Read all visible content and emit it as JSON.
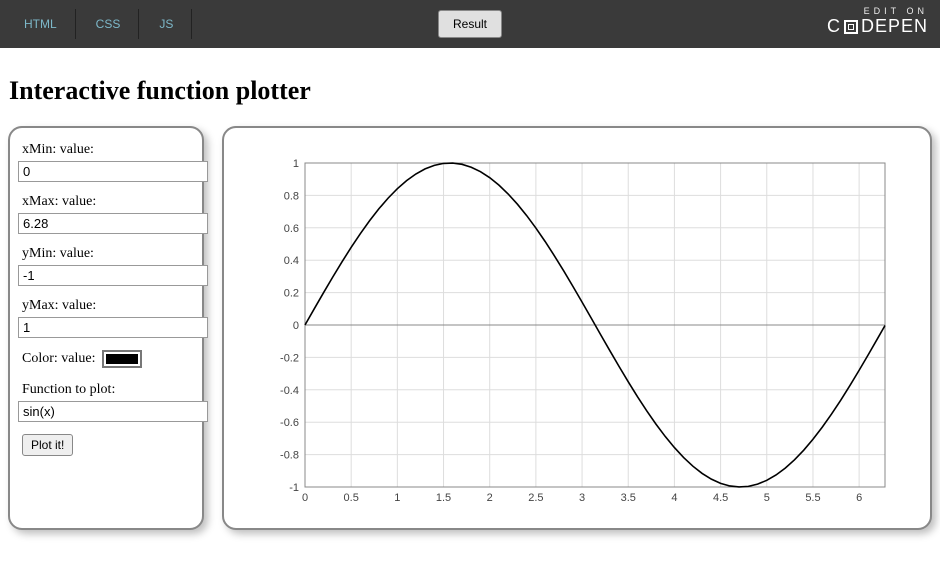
{
  "topbar": {
    "tabs": [
      "HTML",
      "CSS",
      "JS"
    ],
    "result_label": "Result",
    "edit_on": "EDIT ON",
    "brand_left": "C",
    "brand_right": "DEPEN"
  },
  "page": {
    "title": "Interactive function plotter"
  },
  "form": {
    "xmin": {
      "label": "xMin: value:",
      "value": "0"
    },
    "xmax": {
      "label": "xMax: value:",
      "value": "6.28"
    },
    "ymin": {
      "label": "yMin: value:",
      "value": "-1"
    },
    "ymax": {
      "label": "yMax: value:",
      "value": "1"
    },
    "color": {
      "label": "Color: value:",
      "value": "#000000"
    },
    "func": {
      "label": "Function to plot:",
      "value": "sin(x)"
    },
    "plot_label": "Plot it!"
  },
  "chart_data": {
    "type": "line",
    "title": "",
    "xlabel": "",
    "ylabel": "",
    "xlim": [
      0,
      6.28
    ],
    "ylim": [
      -1,
      1
    ],
    "xticks": [
      0,
      0.5,
      1,
      1.5,
      2,
      2.5,
      3,
      3.5,
      4,
      4.5,
      5,
      5.5,
      6
    ],
    "yticks": [
      -1,
      -0.8,
      -0.6,
      -0.4,
      -0.2,
      0,
      0.2,
      0.4,
      0.6,
      0.8,
      1
    ],
    "series": [
      {
        "name": "sin(x)",
        "color": "#000000",
        "x": [
          0,
          0.1,
          0.2,
          0.3,
          0.4,
          0.5,
          0.6,
          0.7,
          0.8,
          0.9,
          1,
          1.1,
          1.2,
          1.3,
          1.4,
          1.5,
          1.6,
          1.7,
          1.8,
          1.9,
          2,
          2.1,
          2.2,
          2.3,
          2.4,
          2.5,
          2.6,
          2.7,
          2.8,
          2.9,
          3,
          3.1,
          3.2,
          3.3,
          3.4,
          3.5,
          3.6,
          3.7,
          3.8,
          3.9,
          4,
          4.1,
          4.2,
          4.3,
          4.4,
          4.5,
          4.6,
          4.7,
          4.8,
          4.9,
          5,
          5.1,
          5.2,
          5.3,
          5.4,
          5.5,
          5.6,
          5.7,
          5.8,
          5.9,
          6,
          6.1,
          6.2,
          6.28
        ],
        "y": [
          0,
          0.0998,
          0.1987,
          0.2955,
          0.3894,
          0.4794,
          0.5646,
          0.6442,
          0.7174,
          0.7833,
          0.8415,
          0.8912,
          0.932,
          0.9636,
          0.9854,
          0.9975,
          0.9996,
          0.9917,
          0.9738,
          0.9463,
          0.9093,
          0.8632,
          0.8085,
          0.7457,
          0.6755,
          0.5985,
          0.5155,
          0.4274,
          0.335,
          0.2392,
          0.1411,
          0.0416,
          -0.0584,
          -0.1577,
          -0.2555,
          -0.3508,
          -0.4425,
          -0.5298,
          -0.6119,
          -0.6878,
          -0.7568,
          -0.8183,
          -0.8716,
          -0.9162,
          -0.9516,
          -0.9775,
          -0.9937,
          -0.9999,
          -0.9962,
          -0.9825,
          -0.9589,
          -0.9258,
          -0.8835,
          -0.8323,
          -0.7728,
          -0.7055,
          -0.6313,
          -0.5507,
          -0.4646,
          -0.3739,
          -0.2794,
          -0.1822,
          -0.0831,
          -0.0032
        ]
      }
    ]
  }
}
